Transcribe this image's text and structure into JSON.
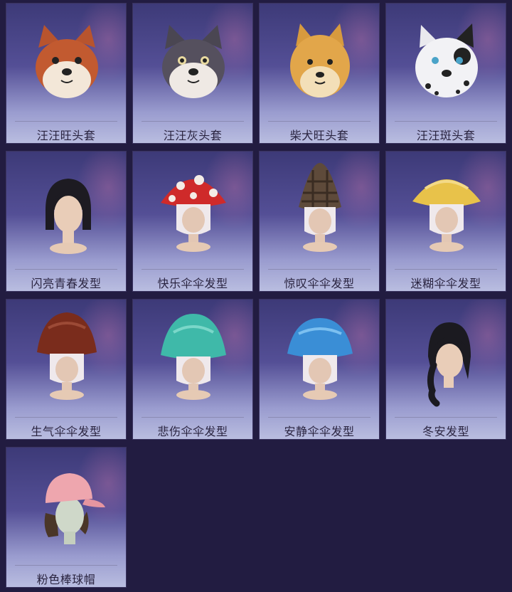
{
  "items": [
    {
      "label": "汪汪旺头套",
      "icon": "shiba-red-dog-head-icon"
    },
    {
      "label": "汪汪灰头套",
      "icon": "husky-gray-dog-head-icon"
    },
    {
      "label": "柴犬旺头套",
      "icon": "shiba-dog-head-icon"
    },
    {
      "label": "汪汪斑头套",
      "icon": "dalmatian-dog-head-icon"
    },
    {
      "label": "闪亮青春发型",
      "icon": "bob-hairstyle-icon"
    },
    {
      "label": "快乐伞伞发型",
      "icon": "red-mushroom-hat-icon"
    },
    {
      "label": "惊叹伞伞发型",
      "icon": "morel-mushroom-hat-icon"
    },
    {
      "label": "迷糊伞伞发型",
      "icon": "yellow-mushroom-hat-icon"
    },
    {
      "label": "生气伞伞发型",
      "icon": "brown-mushroom-hat-icon"
    },
    {
      "label": "悲伤伞伞发型",
      "icon": "teal-mushroom-hat-icon"
    },
    {
      "label": "安静伞伞发型",
      "icon": "blue-mushroom-hat-icon"
    },
    {
      "label": "冬安发型",
      "icon": "long-braid-hairstyle-icon"
    },
    {
      "label": "粉色棒球帽",
      "icon": "pink-baseball-cap-icon"
    }
  ],
  "colors": {
    "background": "#221c41",
    "label_text": "#2a2440"
  }
}
